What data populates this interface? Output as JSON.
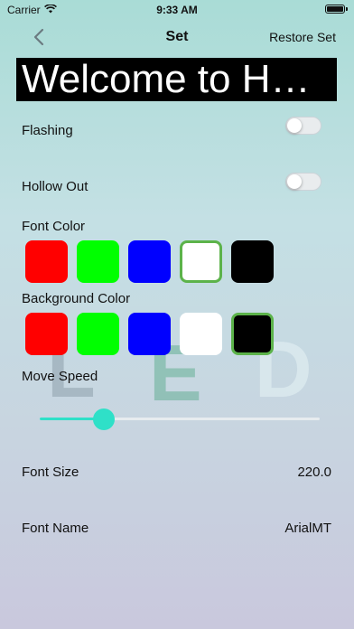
{
  "status": {
    "carrier": "Carrier",
    "time": "9:33 AM"
  },
  "nav": {
    "title": "Set",
    "restore": "Restore Set"
  },
  "banner": {
    "text": "Welcome to H…"
  },
  "flashing": {
    "label": "Flashing",
    "on": false
  },
  "hollow": {
    "label": "Hollow Out",
    "on": false
  },
  "font_color": {
    "label": "Font Color",
    "swatches": [
      "#ff0000",
      "#00ff00",
      "#0000ff",
      "#ffffff",
      "#000000"
    ],
    "selected_index": 3
  },
  "background_color": {
    "label": "Background Color",
    "swatches": [
      "#ff0000",
      "#00ff00",
      "#0000ff",
      "#ffffff",
      "#000000"
    ],
    "selected_index": 4
  },
  "watermark": {
    "letters": [
      "L",
      "E",
      "D"
    ]
  },
  "move_speed": {
    "label": "Move Speed",
    "fraction": 0.23
  },
  "font_size": {
    "label": "Font Size",
    "value": "220.0"
  },
  "font_name": {
    "label": "Font Name",
    "value": "ArialMT"
  },
  "accent_color": "#2fe0c8",
  "selection_color": "#5cb34a"
}
